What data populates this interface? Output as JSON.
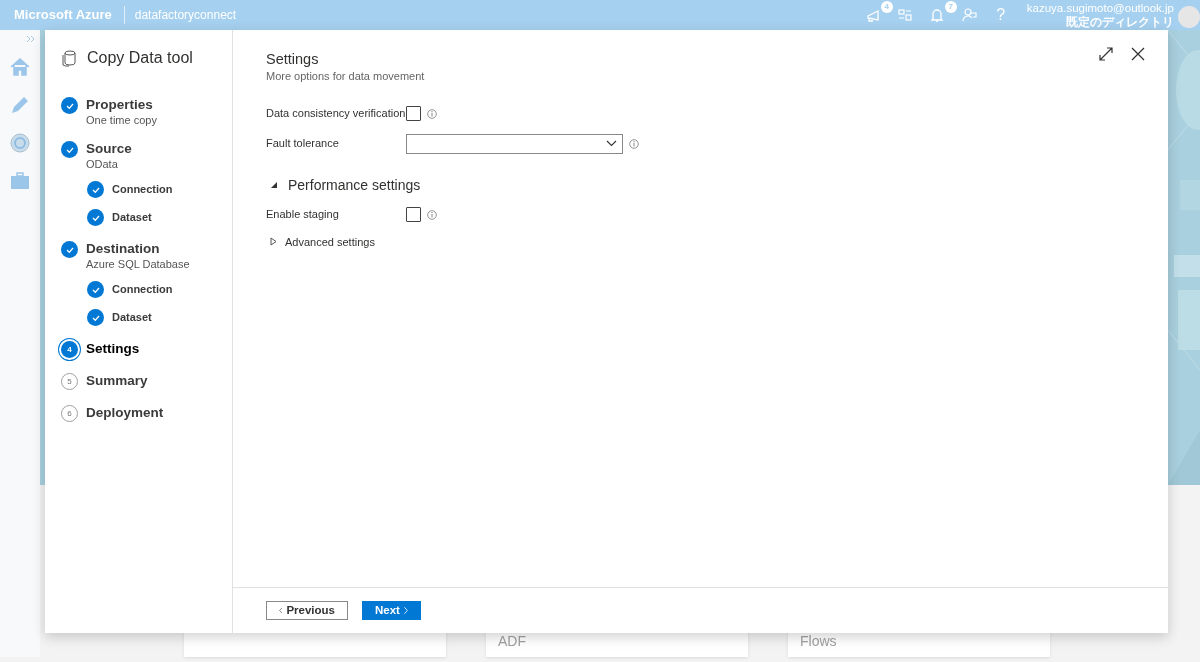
{
  "header": {
    "brand": "Microsoft Azure",
    "resource": "datafactoryconnect",
    "badges": [
      {
        "kind": "feedback",
        "count": "4"
      },
      {
        "kind": "switch"
      },
      {
        "kind": "bell",
        "count": "7"
      },
      {
        "kind": "person"
      },
      {
        "kind": "help",
        "label": "?"
      }
    ],
    "user": {
      "email": "kazuya.sugimoto@outlook.jp",
      "directory": "既定のディレクトリ"
    }
  },
  "rail": {
    "items": [
      {
        "kind": "home"
      },
      {
        "kind": "pencil"
      },
      {
        "kind": "monitor"
      },
      {
        "kind": "toolbox"
      }
    ]
  },
  "background_cards": [
    {
      "kind": "blank"
    },
    {
      "kind": "titled",
      "title": "ADF"
    },
    {
      "kind": "titled",
      "title": "Flows"
    }
  ],
  "dialog": {
    "title": "Copy Data tool",
    "steps": [
      {
        "label": "Properties",
        "subtitle": "One time copy",
        "done": true,
        "selected": false
      },
      {
        "label": "Source",
        "subtitle": "OData",
        "done": true,
        "selected": false,
        "children": [
          {
            "label": "Connection",
            "done": true,
            "selected": false
          },
          {
            "label": "Dataset",
            "done": true,
            "selected": false
          }
        ]
      },
      {
        "label": "Destination",
        "subtitle": "Azure SQL Database",
        "done": true,
        "selected": false,
        "children": [
          {
            "label": "Connection",
            "done": true,
            "selected": false
          },
          {
            "label": "Dataset",
            "done": true,
            "selected": false
          }
        ]
      },
      {
        "label": "Settings",
        "number": "4",
        "done": false,
        "selected": true
      },
      {
        "label": "Summary",
        "number": "5",
        "done": false,
        "selected": false
      },
      {
        "label": "Deployment",
        "number": "6",
        "done": false,
        "selected": false
      }
    ],
    "heading": "Settings",
    "subheading": "More options for data movement",
    "fields": [
      {
        "kind": "checkbox",
        "label": "Data consistency verification",
        "checked": false
      },
      {
        "kind": "select",
        "label": "Fault tolerance"
      }
    ],
    "performance": {
      "title": "Performance settings",
      "expanded": true,
      "fields": [
        {
          "kind": "checkbox",
          "label": "Enable staging",
          "checked": false
        }
      ],
      "advanced": {
        "label": "Advanced settings",
        "expanded": false
      }
    },
    "buttons": [
      {
        "kind": "previous",
        "label": "Previous"
      },
      {
        "kind": "next",
        "label": "Next"
      }
    ]
  }
}
